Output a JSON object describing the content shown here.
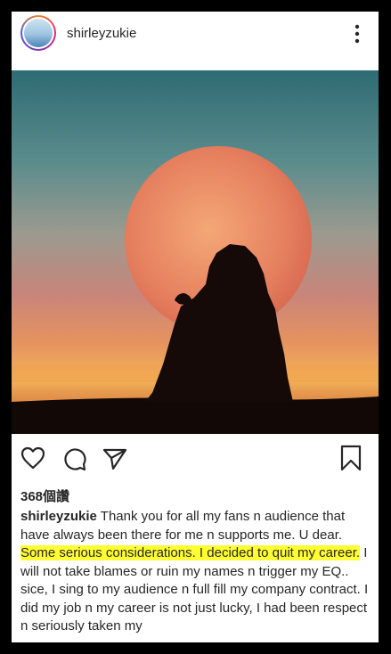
{
  "post": {
    "username": "shirleyzukie",
    "likes": "368個讚",
    "caption": {
      "username": "shirleyzukie",
      "text_before": "Thank you for all my fans n audience that have always been there for me n supports me. U dear.",
      "highlight": "Some serious considerations. I decided to quit my career.",
      "text_after": "I will not take blames or ruin my names n trigger my EQ.. sice, I sing to my audience n full fill my company contract. I did my job n my career is not just lucky, I had been respect n seriously taken my"
    }
  },
  "icons": {
    "more": "more-vertical-icon",
    "like": "heart-icon",
    "comment": "comment-icon",
    "share": "send-icon",
    "save": "bookmark-icon"
  },
  "colors": {
    "highlight": "#ffff33",
    "text": "#262626",
    "frame": "#000000"
  }
}
